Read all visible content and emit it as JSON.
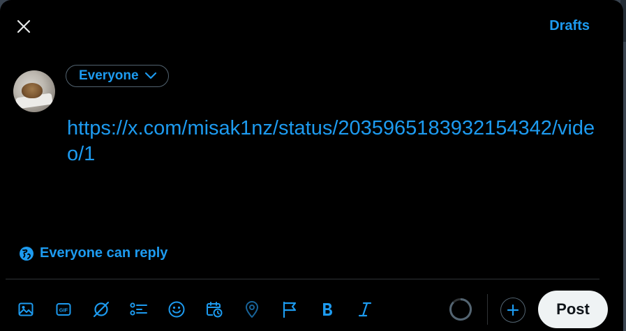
{
  "colors": {
    "accent": "#1d9bf0",
    "background": "#000000",
    "text_primary": "#e7e9ea",
    "post_button_bg": "#eff3f4"
  },
  "header": {
    "close_icon": "close-icon",
    "drafts_label": "Drafts"
  },
  "composer": {
    "audience_label": "Everyone",
    "text": "https://x.com/misak1nz/status/2035965183932154342/video/1",
    "reply_setting_label": "Everyone can reply"
  },
  "toolbar": {
    "icons": [
      "image-icon",
      "gif-icon",
      "grok-icon",
      "poll-icon",
      "emoji-icon",
      "schedule-icon",
      "location-icon",
      "flag-icon",
      "bold-icon",
      "italic-icon"
    ],
    "post_label": "Post"
  }
}
